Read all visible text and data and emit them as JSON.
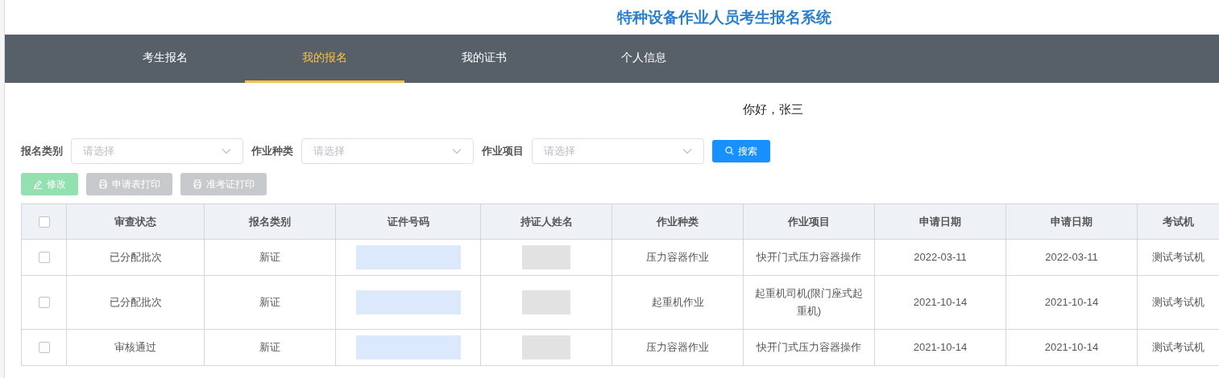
{
  "title": "特种设备作业人员考生报名系统",
  "nav": [
    {
      "label": "考生报名",
      "selected": false
    },
    {
      "label": "我的报名",
      "selected": true
    },
    {
      "label": "我的证书",
      "selected": false
    },
    {
      "label": "个人信息",
      "selected": false
    }
  ],
  "greeting": "你好，张三",
  "filters": [
    {
      "label": "报名类别",
      "placeholder": "请选择"
    },
    {
      "label": "作业种类",
      "placeholder": "请选择"
    },
    {
      "label": "作业项目",
      "placeholder": "请选择"
    }
  ],
  "search_button": "搜索",
  "actions": [
    {
      "label": "修改",
      "kind": "edit",
      "disabled": true
    },
    {
      "label": "申请表打印",
      "kind": "print",
      "disabled": true
    },
    {
      "label": "准考证打印",
      "kind": "print",
      "disabled": true
    }
  ],
  "table": {
    "select_all": {
      "checked": false
    },
    "columns": [
      "审查状态",
      "报名类别",
      "证件号码",
      "持证人姓名",
      "作业种类",
      "作业项目",
      "申请日期",
      "申请日期",
      "考试机"
    ],
    "rows": [
      {
        "checked": false,
        "cells": [
          "已分配批次",
          "新证",
          null,
          null,
          "压力容器作业",
          "快开门式压力容器操作",
          "2022-03-11",
          "2022-03-11",
          "测试考试机"
        ]
      },
      {
        "checked": false,
        "cells": [
          "已分配批次",
          "新证",
          null,
          null,
          "起重机作业",
          "起重机司机(限门座式起重机)",
          "2021-10-14",
          "2021-10-14",
          "测试考试机"
        ]
      },
      {
        "checked": false,
        "cells": [
          "审核通过",
          "新证",
          null,
          null,
          "压力容器作业",
          "快开门式压力容器操作",
          "2021-10-14",
          "2021-10-14",
          "测试考试机"
        ]
      }
    ]
  }
}
